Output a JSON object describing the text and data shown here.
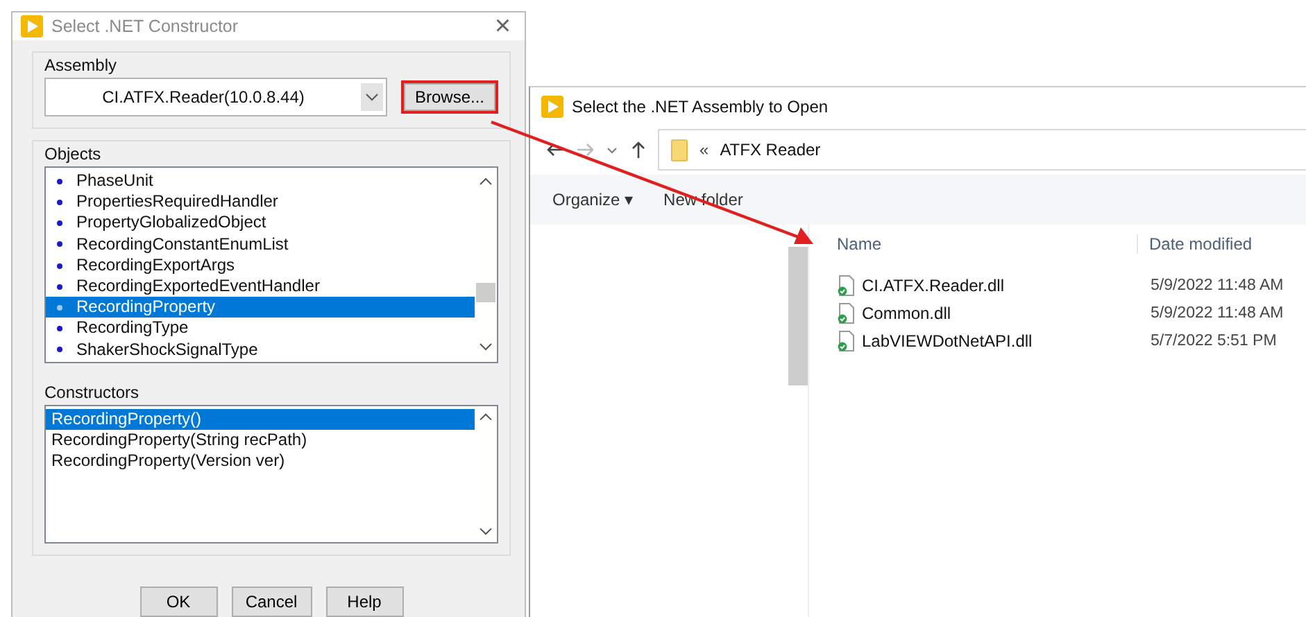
{
  "constructor_dialog": {
    "title": "Select .NET Constructor",
    "close": "×",
    "assembly": {
      "label": "Assembly",
      "value": "CI.ATFX.Reader(10.0.8.44)",
      "browse": {
        "label": "Browse...",
        "highlighted": true
      }
    },
    "objects": {
      "label": "Objects",
      "items": [
        {
          "label": "PhaseUnit",
          "selected": false
        },
        {
          "label": "PropertiesRequiredHandler",
          "selected": false
        },
        {
          "label": "PropertyGlobalizedObject",
          "selected": false
        },
        {
          "label": "RecordingConstantEnumList",
          "selected": false
        },
        {
          "label": "RecordingExportArgs",
          "selected": false
        },
        {
          "label": "RecordingExportedEventHandler",
          "selected": false
        },
        {
          "label": "RecordingProperty",
          "selected": true
        },
        {
          "label": "RecordingType",
          "selected": false
        },
        {
          "label": "ShakerShockSignalType",
          "selected": false
        }
      ]
    },
    "constructors": {
      "label": "Constructors",
      "items": [
        {
          "label": "RecordingProperty()",
          "selected": true
        },
        {
          "label": "RecordingProperty(String recPath)",
          "selected": false
        },
        {
          "label": "RecordingProperty(Version ver)",
          "selected": false
        }
      ]
    },
    "buttons": [
      "OK",
      "Cancel",
      "Help"
    ]
  },
  "open_dialog": {
    "title": "Select the .NET Assembly to Open",
    "breadcrumb": {
      "prefix": "«",
      "folder": "ATFX Reader"
    },
    "toolbar": {
      "organize": "Organize ▾",
      "new_folder": "New folder"
    },
    "columns": [
      "Name",
      "Date modified"
    ],
    "files": [
      {
        "name": "CI.ATFX.Reader.dll",
        "date": "5/9/2022 11:48 AM"
      },
      {
        "name": "Common.dll",
        "date": "5/9/2022 11:48 AM"
      },
      {
        "name": "LabVIEWDotNetAPI.dll",
        "date": "5/7/2022 5:51 PM"
      }
    ]
  }
}
